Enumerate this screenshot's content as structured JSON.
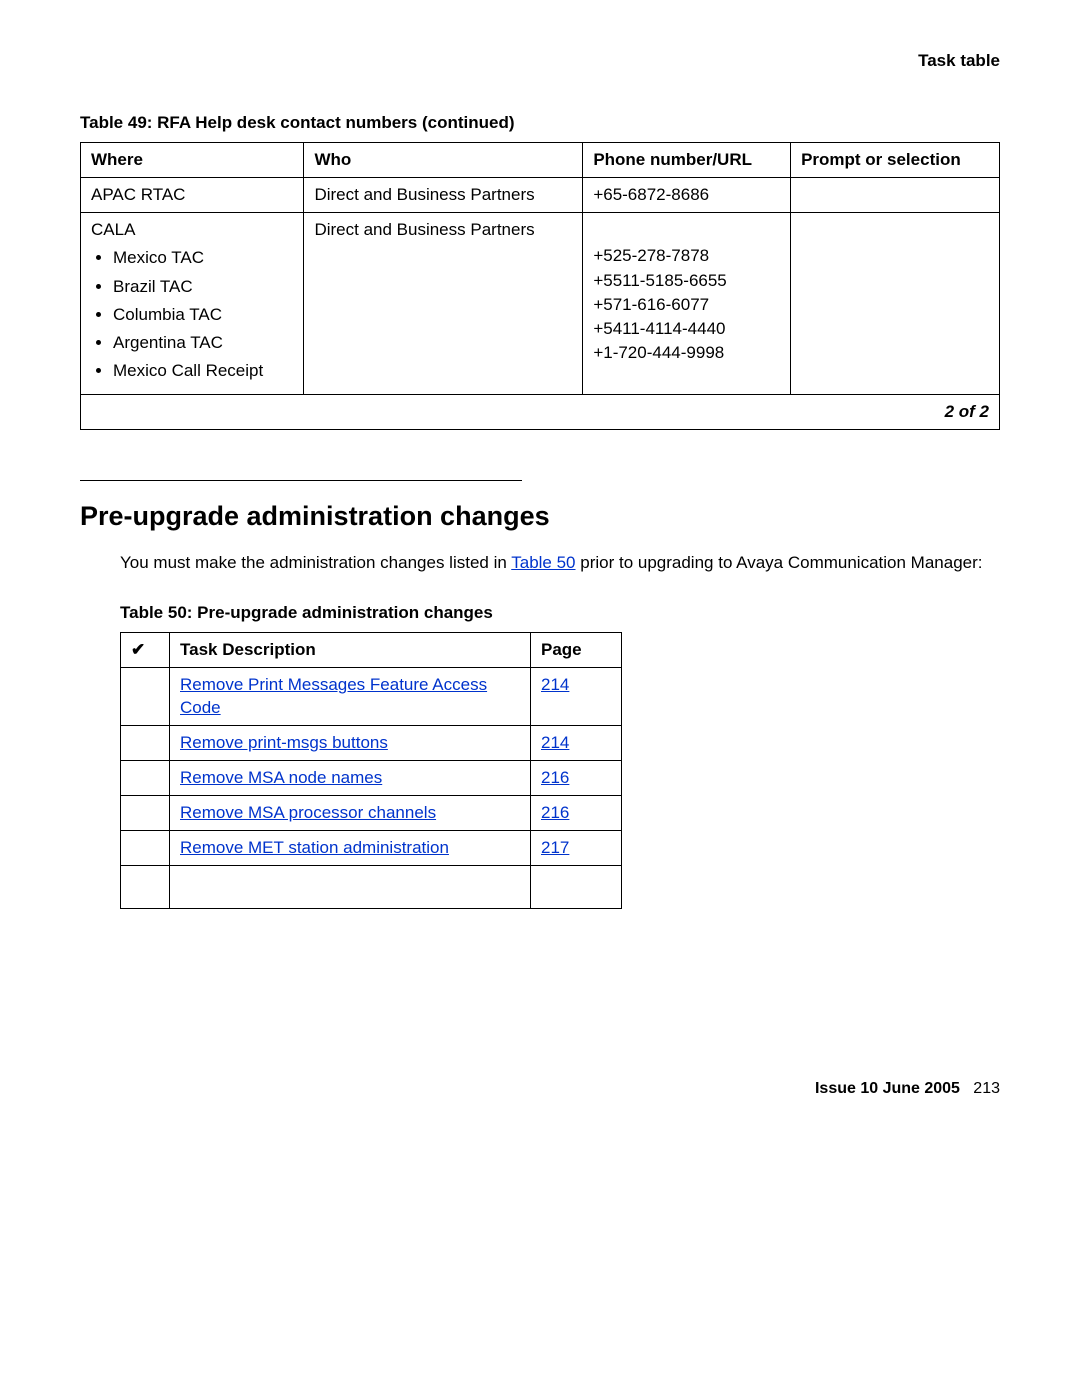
{
  "header": {
    "section_label": "Task table"
  },
  "table49": {
    "caption": "Table 49: RFA Help desk contact numbers  (continued)",
    "columns": {
      "c1": "Where",
      "c2": "Who",
      "c3": "Phone number/URL",
      "c4": "Prompt or selection"
    },
    "row1": {
      "where": "APAC RTAC",
      "who": "Direct and Business Partners",
      "phone": "+65-6872-8686",
      "prompt": ""
    },
    "row2": {
      "where_head": "CALA",
      "bullets": [
        "Mexico TAC",
        "Brazil TAC",
        "Columbia TAC",
        "Argentina TAC",
        "Mexico Call Receipt"
      ],
      "who": "Direct and Business Partners",
      "phones": [
        "+525-278-7878",
        "+5511-5185-6655",
        "+571-616-6077",
        "+5411-4114-4440",
        "+1-720-444-9998"
      ],
      "prompt": ""
    },
    "pager": "2 of 2"
  },
  "section": {
    "title": "Pre-upgrade administration changes",
    "para_pre": "You must make the administration changes listed in ",
    "para_link": "Table 50",
    "para_post": " prior to upgrading to Avaya Communication Manager:"
  },
  "table50": {
    "caption": "Table 50: Pre-upgrade administration changes",
    "columns": {
      "check": "✔",
      "desc": "Task Description",
      "page": "Page"
    },
    "rows": [
      {
        "desc": "Remove Print Messages Feature Access Code",
        "page": "214"
      },
      {
        "desc": "Remove print-msgs buttons",
        "page": "214"
      },
      {
        "desc": "Remove MSA node names",
        "page": "216"
      },
      {
        "desc": "Remove MSA processor channels",
        "page": "216"
      },
      {
        "desc": "Remove MET station administration",
        "page": "217"
      }
    ]
  },
  "footer": {
    "issue": "Issue 10    June 2005",
    "page": "213"
  }
}
